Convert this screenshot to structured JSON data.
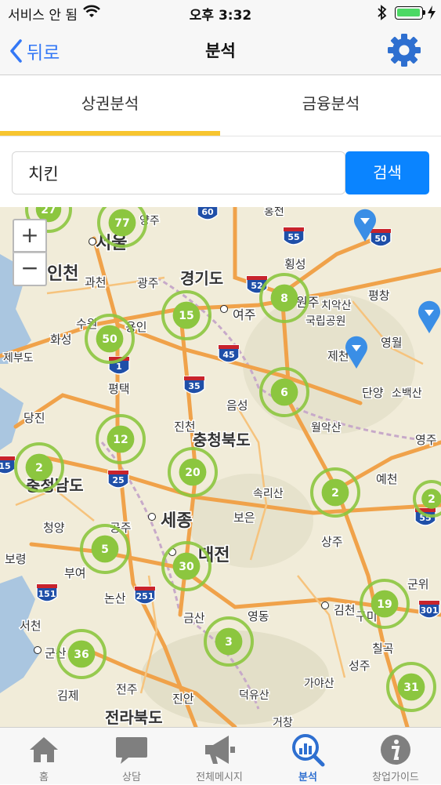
{
  "status_bar": {
    "carrier": "서비스 안 됨",
    "time": "오후 3:32"
  },
  "nav": {
    "back_label": "뒤로",
    "title": "분석"
  },
  "tabs": [
    {
      "label": "상권분석",
      "active": true
    },
    {
      "label": "금융분석",
      "active": false
    }
  ],
  "search": {
    "value": "치킨",
    "button_label": "검색"
  },
  "map": {
    "zoom_in": "+",
    "zoom_out": "−",
    "place_labels": [
      "서울",
      "인천",
      "과천",
      "광주",
      "경기도",
      "여주",
      "원주",
      "치악산",
      "국립공원",
      "평창",
      "영월",
      "제천",
      "수원",
      "용인",
      "화성",
      "제부도",
      "평택",
      "당진",
      "음성",
      "단양",
      "소백산",
      "진천",
      "충청북도",
      "월악산",
      "충청남도",
      "청양",
      "세종",
      "공주",
      "보은",
      "속리산",
      "대전",
      "부여",
      "보령",
      "논산",
      "상주",
      "예천",
      "영주",
      "서천",
      "군산",
      "금산",
      "영동",
      "김천",
      "구미",
      "군위",
      "칠곡",
      "성주",
      "김제",
      "전주",
      "진안",
      "덕유산",
      "가야산",
      "거창",
      "전라북도",
      "홍천",
      "횡성",
      "양주"
    ],
    "road_shields": [
      "60",
      "55",
      "50",
      "52",
      "45",
      "35",
      "25",
      "1",
      "15",
      "151",
      "251",
      "301",
      "55"
    ],
    "clusters": [
      "27",
      "77",
      "8",
      "15",
      "50",
      "6",
      "12",
      "2",
      "20",
      "2",
      "5",
      "30",
      "19",
      "3",
      "36",
      "31",
      "2"
    ]
  },
  "tabbar": [
    {
      "label": "홈",
      "icon": "home-icon"
    },
    {
      "label": "상담",
      "icon": "chat-bubble-icon"
    },
    {
      "label": "전체메시지",
      "icon": "megaphone-icon"
    },
    {
      "label": "분석",
      "icon": "analysis-search-icon",
      "active": true
    },
    {
      "label": "창업가이드",
      "icon": "info-icon"
    }
  ],
  "colors": {
    "accent": "#0a84ff",
    "tab_indicator": "#f7c530",
    "cluster": "#8cc63f",
    "active_tab": "#2e6fd0"
  }
}
